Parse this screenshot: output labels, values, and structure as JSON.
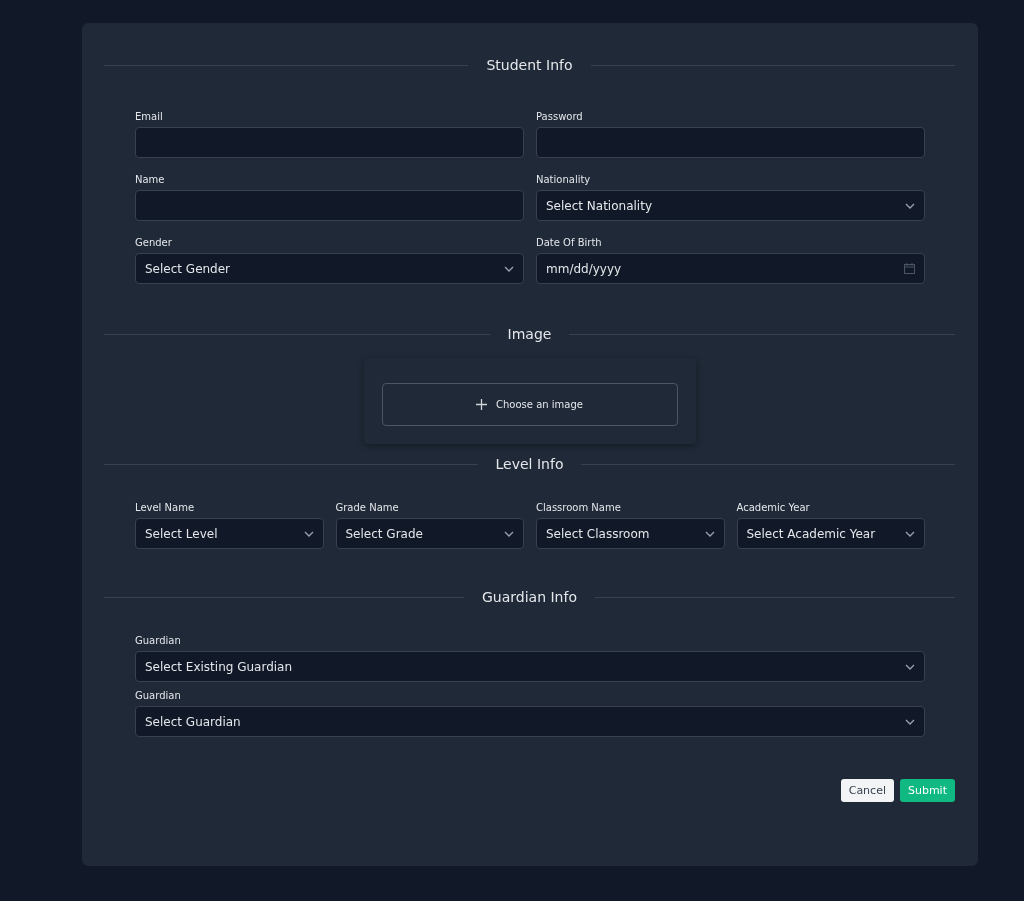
{
  "sections": [
    {
      "title": "Student Info",
      "kind": "grid2",
      "fields": [
        {
          "label": "Email",
          "kind": "text"
        },
        {
          "label": "Password",
          "kind": "password"
        },
        {
          "label": "Name",
          "kind": "text"
        },
        {
          "label": "Nationality",
          "kind": "select",
          "value": "Select Nationality"
        },
        {
          "label": "Gender",
          "kind": "select",
          "value": "Select Gender"
        },
        {
          "label": "Date Of Birth",
          "kind": "date",
          "placeholder": "mm/dd/yyyy"
        }
      ]
    },
    {
      "title": "Image",
      "kind": "upload",
      "button": "Choose an image"
    },
    {
      "title": "Level Info",
      "kind": "grid4",
      "fields": [
        {
          "label": "Level Name",
          "kind": "select",
          "value": "Select Level"
        },
        {
          "label": "Grade Name",
          "kind": "select",
          "value": "Select Grade"
        },
        {
          "label": "Classroom Name",
          "kind": "select",
          "value": "Select Classroom"
        },
        {
          "label": "Academic Year",
          "kind": "select",
          "value": "Select Academic Year"
        }
      ]
    },
    {
      "title": "Guardian Info",
      "kind": "stack",
      "fields": [
        {
          "label": "Guardian",
          "kind": "select",
          "value": "Select Existing Guardian"
        },
        {
          "label": "Guardian",
          "kind": "select",
          "value": "Select Guardian"
        }
      ]
    }
  ],
  "buttons": [
    {
      "label": "Cancel",
      "kind": "secondary"
    },
    {
      "label": "Submit",
      "kind": "primary"
    }
  ]
}
